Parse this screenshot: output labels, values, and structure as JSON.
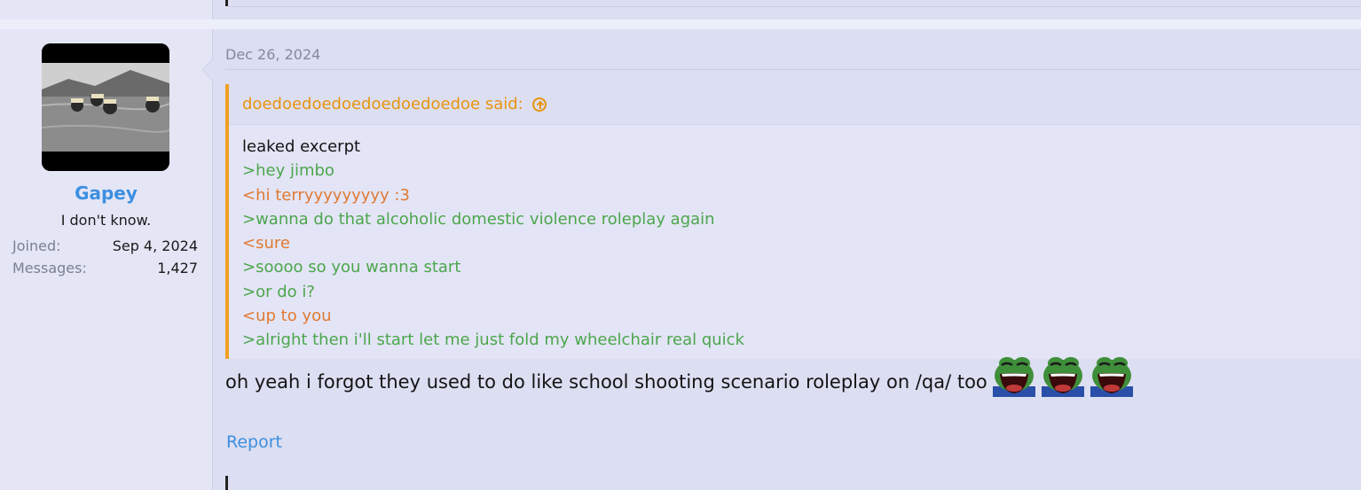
{
  "post": {
    "date": "Dec 26, 2024",
    "user": {
      "name": "Gapey",
      "title": "I don't know.",
      "joined_label": "Joined:",
      "joined_value": "Sep 4, 2024",
      "messages_label": "Messages:",
      "messages_value": "1,427"
    },
    "quote": {
      "author": "doedoedoedoedoedoedoedoe said:",
      "lines": [
        {
          "text": "leaked excerpt",
          "style": "plain"
        },
        {
          "text": ">hey jimbo",
          "style": "green"
        },
        {
          "text": "<hi terryyyyyyyyy :3",
          "style": "orange"
        },
        {
          "text": ">wanna do that alcoholic domestic violence roleplay again",
          "style": "green"
        },
        {
          "text": "<sure",
          "style": "orange"
        },
        {
          "text": ">soooo so you wanna start",
          "style": "green"
        },
        {
          "text": ">or do i?",
          "style": "green"
        },
        {
          "text": "<up to you",
          "style": "orange"
        },
        {
          "text": ">alright then i'll start let me just fold my wheelchair real quick",
          "style": "green"
        }
      ]
    },
    "message": "oh yeah i forgot they used to do like school shooting scenario roleplay on /qa/ too",
    "emotes": [
      "laughing-pepe",
      "laughing-pepe",
      "laughing-pepe"
    ],
    "report_label": "Report"
  },
  "colors": {
    "accent": "#3d8fe0",
    "quote_author": "#e8940f",
    "greentext": "#4ca64c",
    "orangetext": "#e07a33"
  }
}
